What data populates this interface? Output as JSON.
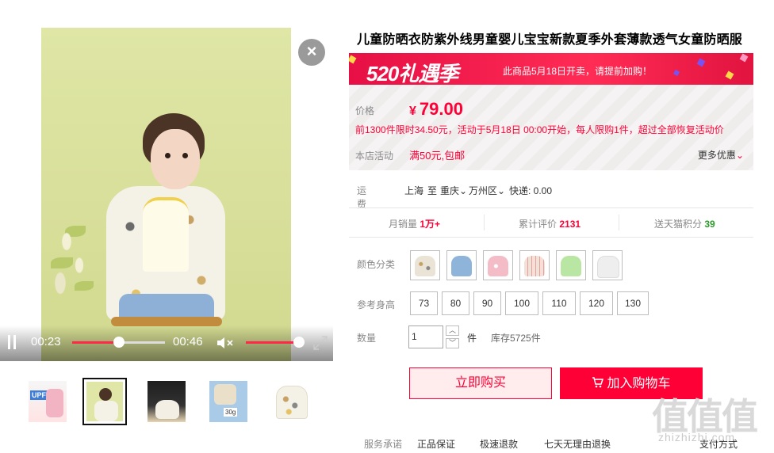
{
  "video": {
    "current_time": "00:23",
    "duration": "00:46",
    "progress": 0.5,
    "volume": 0.9,
    "icons": [
      "pause-icon",
      "mute-icon",
      "fullscreen-icon",
      "close-icon"
    ]
  },
  "thumbnails": [
    {
      "name": "upf-50-jacket-thumb",
      "badge": "UPF 50+"
    },
    {
      "name": "kid-model-thumb",
      "active": true
    },
    {
      "name": "dark-product-thumb"
    },
    {
      "name": "folded-jacket-thumb",
      "badge": "30g"
    },
    {
      "name": "jacket-front-thumb"
    }
  ],
  "product": {
    "title": "儿童防晒衣防紫外线男童婴儿宝宝新款夏季外套薄款透气女童防晒服",
    "promo": {
      "logo": "520礼遇季",
      "notice": "此商品5月18日开卖，请提前加购！"
    },
    "price_label": "价格",
    "currency": "¥",
    "price": "79.00",
    "limit_text": "前1300件限时34.50元，活动于5月18日 00:00开始，每人限购1件，超过全部恢复活动价",
    "store_activity_label": "本店活动",
    "store_activity": "满50元,包邮",
    "more_offers": "更多优惠"
  },
  "shipping": {
    "label": "运费",
    "from": "上海",
    "to_word": "至",
    "city": "重庆",
    "district": "万州区",
    "express": "快递: 0.00"
  },
  "stats": {
    "monthly_sales_label": "月销量",
    "monthly_sales": "1万+",
    "reviews_label": "累计评价",
    "reviews": "2131",
    "points_label": "送天猫积分",
    "points": "39"
  },
  "options": {
    "color_label": "颜色分类",
    "colors": [
      {
        "name": "white-pattern",
        "hex": "#e9e4d6"
      },
      {
        "name": "blue",
        "hex": "#8fb4d9"
      },
      {
        "name": "pink",
        "hex": "#f3bcc6"
      },
      {
        "name": "white-stripe",
        "hex": "#f1e1d6"
      },
      {
        "name": "green",
        "hex": "#b9e6a3"
      },
      {
        "name": "white-plain",
        "hex": "#eeeeee"
      }
    ],
    "height_label": "参考身高",
    "heights": [
      "73",
      "80",
      "90",
      "100",
      "110",
      "120",
      "130"
    ],
    "quantity_label": "数量",
    "quantity": "1",
    "unit": "件",
    "stock": "库存5725件"
  },
  "actions": {
    "buy_now": "立即购买",
    "add_to_cart": "加入购物车"
  },
  "service": {
    "label": "服务承诺",
    "items": [
      "正品保证",
      "极速退款",
      "七天无理由退换"
    ],
    "payment_label": "支付方式"
  },
  "watermark": {
    "logo": "值值值",
    "site": "zhizhizhi.com"
  },
  "colors": {
    "brand_red": "#ff0036",
    "banner_red": "#e70f45"
  }
}
